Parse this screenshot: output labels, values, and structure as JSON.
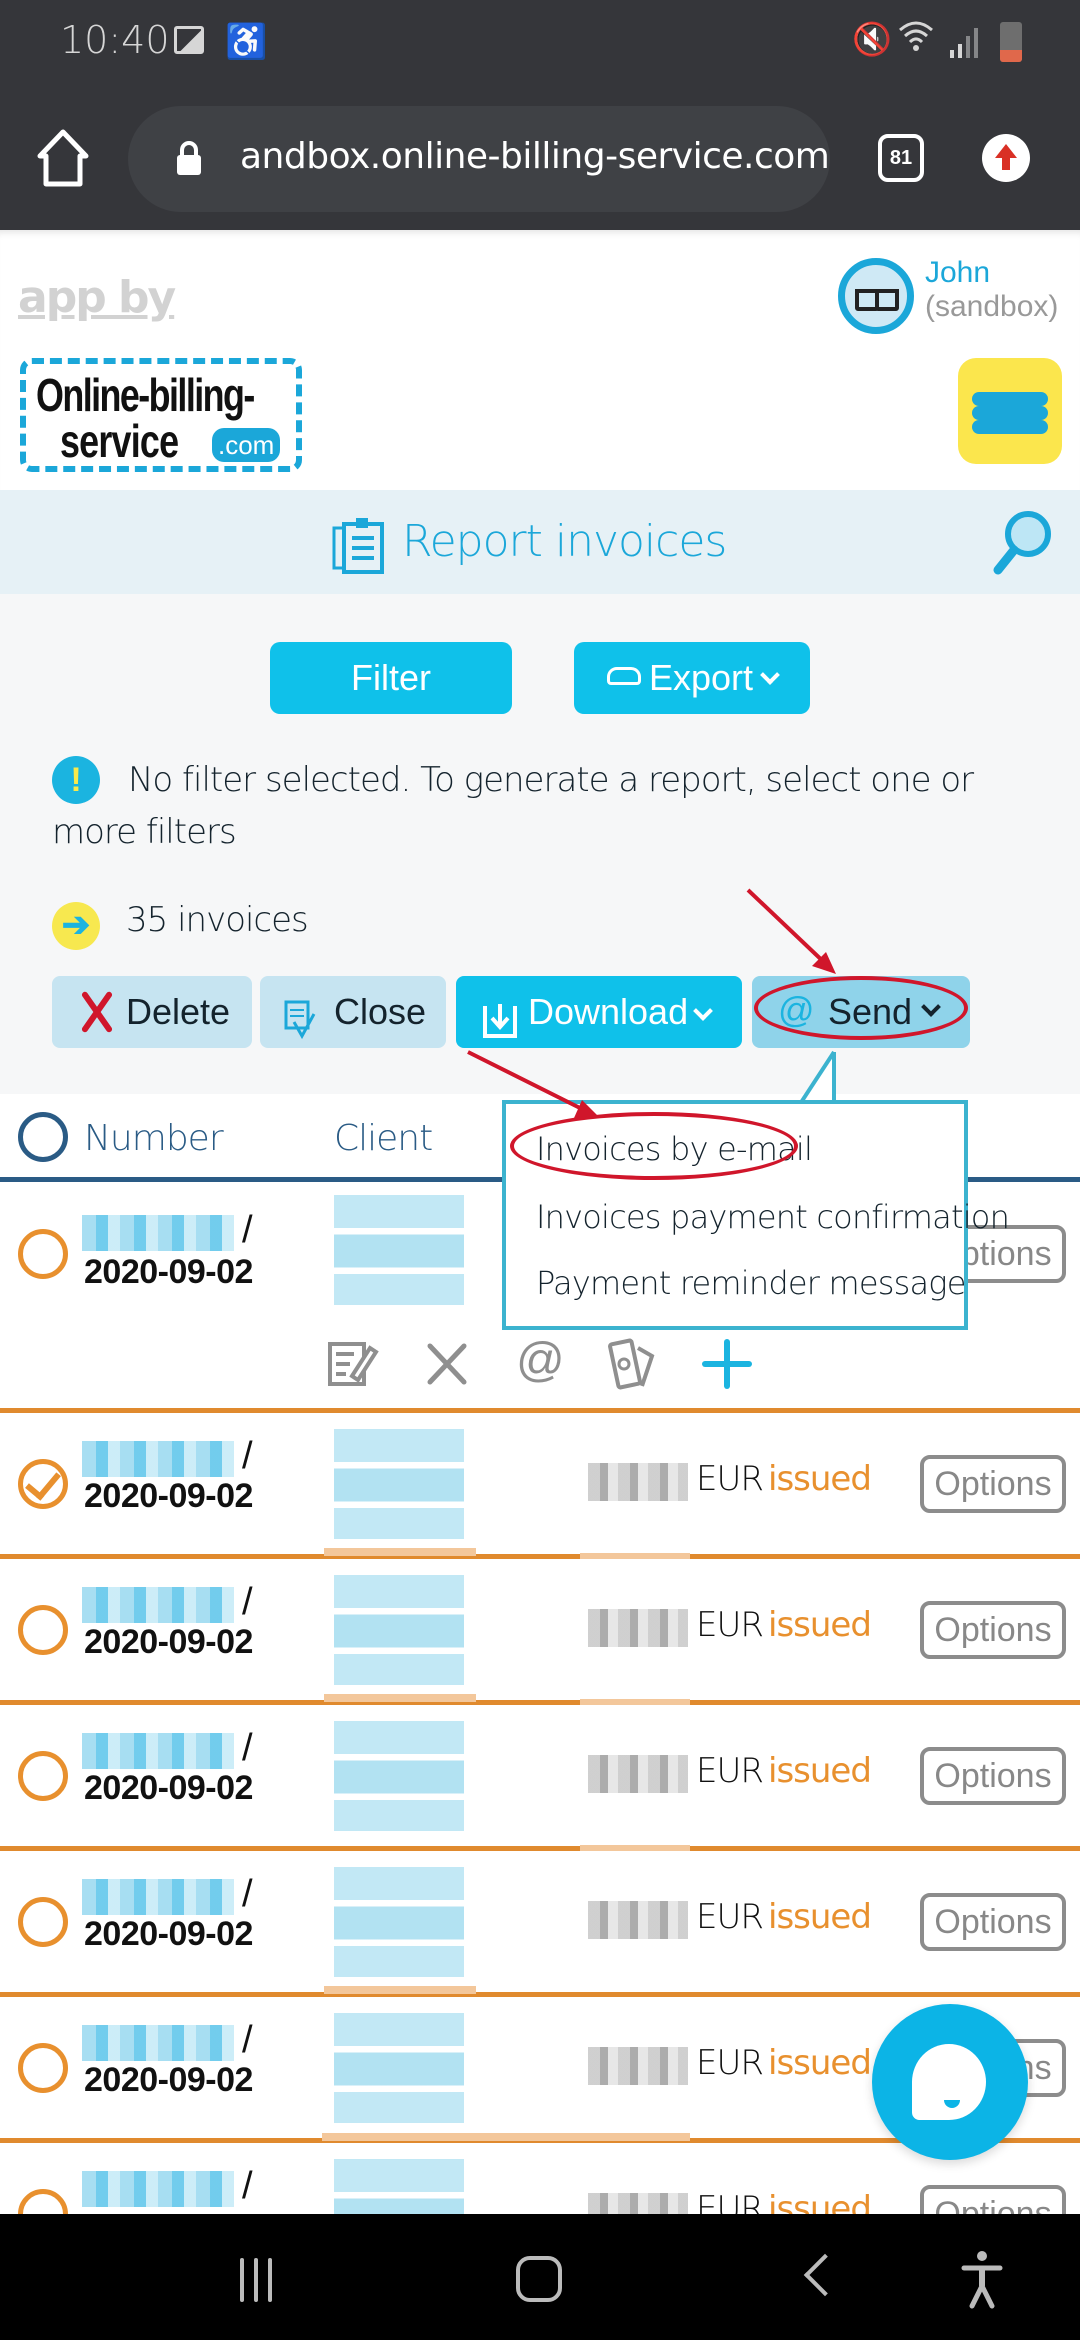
{
  "status_bar": {
    "time": "10:40",
    "icons": [
      "image-icon",
      "accessibility-icon",
      "mute-icon",
      "wifi-icon",
      "signal-icon",
      "battery-icon"
    ]
  },
  "browser": {
    "url": "andbox.online-billing-service.com",
    "tab_count": "81"
  },
  "header": {
    "app_by": "app by",
    "logo_line1": "Online-billing-",
    "logo_line2": "service",
    "logo_dotcom": ".com",
    "user_name": "John",
    "user_role": "(sandbox)"
  },
  "page": {
    "title": "Report invoices"
  },
  "controls": {
    "filter_label": "Filter",
    "export_label": "Export",
    "notice_icon": "!",
    "notice_text": "No filter selected. To generate a report, select one or more filters",
    "count_text": "35 invoices",
    "actions": {
      "delete": "Delete",
      "close": "Close",
      "download": "Download",
      "send": "Send"
    }
  },
  "send_menu": {
    "items": [
      "Invoices by e-mail",
      "Invoices payment confirmation",
      "Payment reminder message"
    ],
    "highlighted": "Invoices by e-mail"
  },
  "table": {
    "columns": [
      "Number",
      "Client"
    ],
    "row_actions": [
      "edit-icon",
      "cancel-icon",
      "email-icon",
      "payment-icon",
      "add-icon"
    ],
    "rows": [
      {
        "number": "(blurred)",
        "date": "2020-09-02",
        "currency": "",
        "status": "",
        "options": "Options",
        "selected": false
      },
      {
        "number": "(blurred)",
        "date": "2020-09-02",
        "currency": "EUR",
        "status": "issued",
        "options": "Options",
        "selected": true
      },
      {
        "number": "(blurred)",
        "date": "2020-09-02",
        "currency": "EUR",
        "status": "issued",
        "options": "Options",
        "selected": false
      },
      {
        "number": "(blurred)",
        "date": "2020-09-02",
        "currency": "EUR",
        "status": "issued",
        "options": "Options",
        "selected": false
      },
      {
        "number": "(blurred)",
        "date": "2020-09-02",
        "currency": "EUR",
        "status": "issued",
        "options": "Options",
        "selected": false
      },
      {
        "number": "(blurred)",
        "date": "2020-09-02",
        "currency": "EUR",
        "status": "issued",
        "options": "Options",
        "selected": false
      },
      {
        "number": "(blurred)",
        "date": "",
        "currency": "EUR",
        "status": "issued",
        "options": "Options",
        "selected": false
      }
    ],
    "slash": "/"
  },
  "colors": {
    "accent": "#0fc1ea",
    "brand_blue": "#1ba7d9",
    "status_issued": "#e8902e",
    "header_navy": "#2a5b85",
    "annotation_red": "#d0162b",
    "menu_yellow": "#fbe64d"
  }
}
